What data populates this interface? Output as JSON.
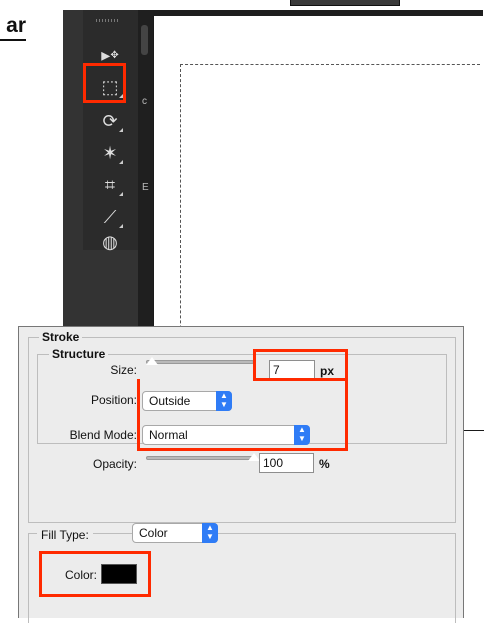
{
  "header_fragment": {
    "text": "ar"
  },
  "photoshop": {
    "tools": [
      {
        "name": "move",
        "glyph": "▸"
      },
      {
        "name": "marquee",
        "glyph": "⬚"
      },
      {
        "name": "lasso",
        "glyph": "⟳"
      },
      {
        "name": "magic-wand",
        "glyph": "✶"
      },
      {
        "name": "crop",
        "glyph": "⌗"
      },
      {
        "name": "eyedropper",
        "glyph": "⟋"
      },
      {
        "name": "healing",
        "glyph": "◍"
      }
    ],
    "side_letters": [
      "c",
      "E"
    ]
  },
  "stroke_dialog": {
    "title": "Stroke",
    "structure": {
      "title": "Structure",
      "size_label": "Size:",
      "size_value": "7",
      "size_unit": "px",
      "position_label": "Position:",
      "position_value": "Outside"
    },
    "blend_mode_label": "Blend Mode:",
    "blend_mode_value": "Normal",
    "opacity_label": "Opacity:",
    "opacity_value": "100",
    "opacity_unit": "%",
    "opacity_slider_fraction": 1.0,
    "fill": {
      "type_label": "Fill Type:",
      "type_value": "Color",
      "color_label": "Color:",
      "color_value": "#000000"
    }
  },
  "highlight_color": "#ff2a00"
}
